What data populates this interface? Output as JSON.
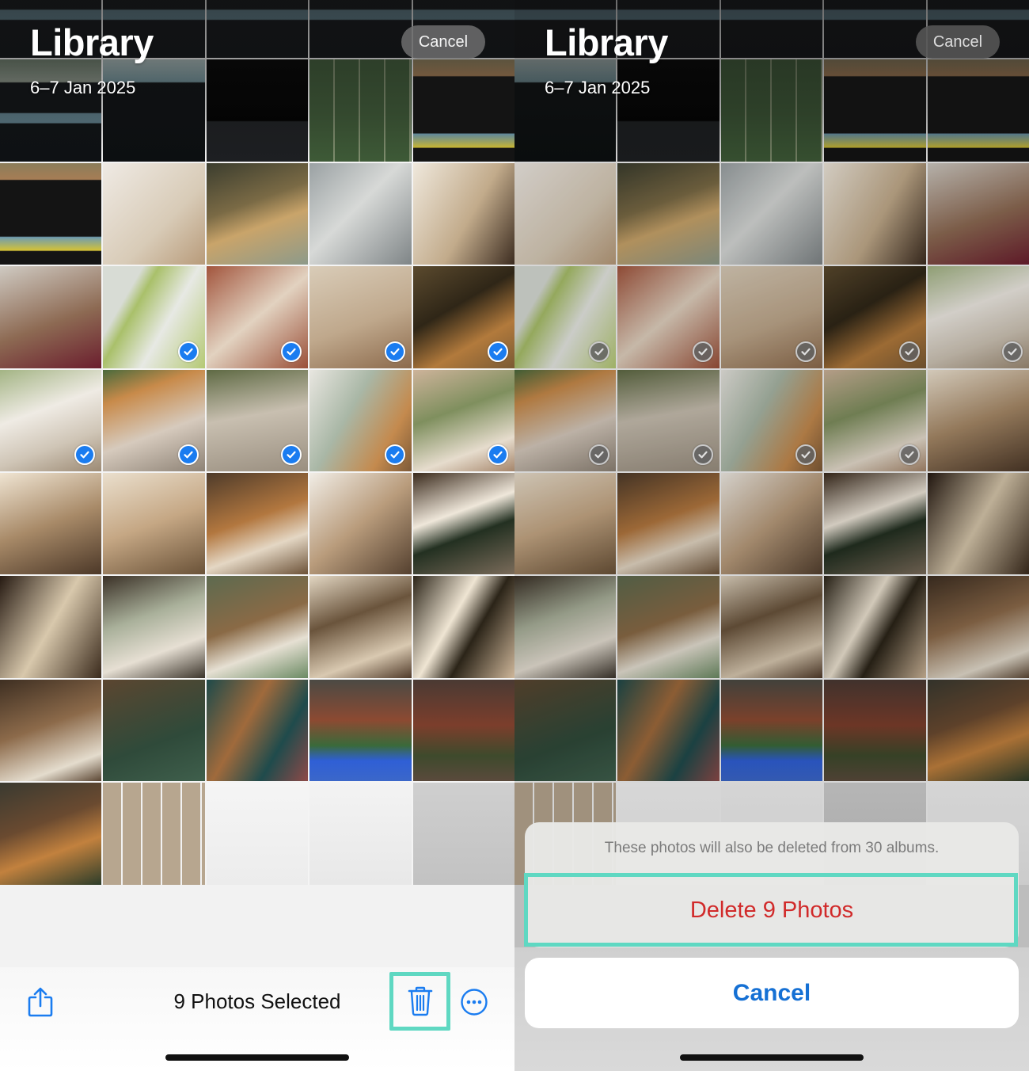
{
  "colors": {
    "accent_blue": "#1a7cf0",
    "destructive_red": "#d12a2a",
    "annotation_teal": "#5fd8c2",
    "cancel_blue": "#1570d4"
  },
  "left_pane": {
    "header": {
      "title": "Library",
      "date_range": "6–7 Jan 2025",
      "cancel_label": "Cancel"
    },
    "toolbar": {
      "share_icon": "share-icon",
      "selection_count_label": "9 Photos Selected",
      "trash_icon": "trash-icon",
      "more_icon": "ellipsis-circle-icon"
    },
    "tiles": [
      {
        "kind": "screenshot-video-editor",
        "selected": false
      },
      {
        "kind": "screenshot-video-editor",
        "selected": false
      },
      {
        "kind": "screenshot-video-editor",
        "selected": false
      },
      {
        "kind": "screenshot-video-editor",
        "selected": false
      },
      {
        "kind": "screenshot-video-editor",
        "selected": false
      },
      {
        "kind": "screenshot-video-editor",
        "selected": false
      },
      {
        "kind": "screenshot-highlight-editor",
        "selected": false
      },
      {
        "kind": "screenshot-no-projects",
        "selected": false
      },
      {
        "kind": "screenshot-photo-picker",
        "selected": false
      },
      {
        "kind": "screenshot-imovie-timeline",
        "selected": false
      },
      {
        "kind": "screenshot-imovie-timeline",
        "selected": false
      },
      {
        "kind": "nursery-interior",
        "selected": false
      },
      {
        "kind": "kitchen-flowers",
        "selected": false
      },
      {
        "kind": "white-tubes-product",
        "selected": false
      },
      {
        "kind": "dining-arched-door",
        "selected": false
      },
      {
        "kind": "arched-kitchen-blossoms",
        "selected": false
      },
      {
        "kind": "green-cosmetic-products",
        "selected": true
      },
      {
        "kind": "terracotta-arched-lounge",
        "selected": true
      },
      {
        "kind": "arched-bathroom",
        "selected": true
      },
      {
        "kind": "moorish-hallway",
        "selected": true
      },
      {
        "kind": "white-courtyard-living",
        "selected": true
      },
      {
        "kind": "orange-tree-courtyard",
        "selected": true
      },
      {
        "kind": "pergola-courtyard",
        "selected": true
      },
      {
        "kind": "lantern-sunroom",
        "selected": true
      },
      {
        "kind": "arched-window-bedroom",
        "selected": true
      },
      {
        "kind": "sunlit-bedroom",
        "selected": false
      },
      {
        "kind": "arched-hallway-stairs",
        "selected": false
      },
      {
        "kind": "staircase-vase",
        "selected": false
      },
      {
        "kind": "bright-staircase-hall",
        "selected": false
      },
      {
        "kind": "dark-archway-mirror",
        "selected": false
      },
      {
        "kind": "dark-doorway-study",
        "selected": false
      },
      {
        "kind": "living-room-garden-view",
        "selected": false
      },
      {
        "kind": "green-bedroom",
        "selected": false
      },
      {
        "kind": "canopy-bedroom-chandelier",
        "selected": false
      },
      {
        "kind": "curtained-bed",
        "selected": false
      },
      {
        "kind": "bookshelf-reading-nook",
        "selected": false
      },
      {
        "kind": "library-green-sofa",
        "selected": false
      },
      {
        "kind": "teal-archway-library",
        "selected": false
      },
      {
        "kind": "brick-cottage-hydrangeas",
        "selected": false
      },
      {
        "kind": "brick-tudor-house",
        "selected": false
      },
      {
        "kind": "cottage-conservatory",
        "selected": false
      },
      {
        "kind": "screenshot-photo-grid",
        "selected": false
      },
      {
        "kind": "screenshot-share-sheet",
        "selected": false
      },
      {
        "kind": "screenshot-albums",
        "selected": false
      },
      {
        "kind": "screenshot-new-album-dialog",
        "selected": false
      }
    ]
  },
  "right_pane": {
    "header": {
      "title": "Library",
      "date_range": "6–7 Jan 2025",
      "cancel_label": "Cancel"
    },
    "action_sheet": {
      "message": "These photos will also be deleted from 30 albums.",
      "delete_label": "Delete 9 Photos",
      "cancel_label": "Cancel"
    },
    "tiles": [
      {
        "kind": "screenshot-video-editor",
        "selected": false
      },
      {
        "kind": "screenshot-video-editor",
        "selected": false
      },
      {
        "kind": "screenshot-video-editor",
        "selected": false
      },
      {
        "kind": "screenshot-video-editor",
        "selected": false
      },
      {
        "kind": "screenshot-video-editor",
        "selected": false
      },
      {
        "kind": "screenshot-highlight-editor",
        "selected": false
      },
      {
        "kind": "screenshot-no-projects",
        "selected": false
      },
      {
        "kind": "screenshot-photo-picker",
        "selected": false
      },
      {
        "kind": "screenshot-imovie-timeline",
        "selected": false
      },
      {
        "kind": "screenshot-imovie-timeline",
        "selected": false
      },
      {
        "kind": "nursery-interior",
        "selected": false
      },
      {
        "kind": "kitchen-flowers",
        "selected": false
      },
      {
        "kind": "white-tubes-product",
        "selected": false
      },
      {
        "kind": "dining-arched-door",
        "selected": false
      },
      {
        "kind": "arched-kitchen-blossoms",
        "selected": false
      },
      {
        "kind": "green-cosmetic-products",
        "selected": true
      },
      {
        "kind": "terracotta-arched-lounge",
        "selected": true
      },
      {
        "kind": "arched-bathroom",
        "selected": true
      },
      {
        "kind": "moorish-hallway",
        "selected": true
      },
      {
        "kind": "white-courtyard-living",
        "selected": true
      },
      {
        "kind": "orange-tree-courtyard",
        "selected": true
      },
      {
        "kind": "pergola-courtyard",
        "selected": true
      },
      {
        "kind": "lantern-sunroom",
        "selected": true
      },
      {
        "kind": "arched-window-bedroom",
        "selected": true
      },
      {
        "kind": "sunlit-bedroom",
        "selected": false
      },
      {
        "kind": "arched-hallway-stairs",
        "selected": false
      },
      {
        "kind": "staircase-vase",
        "selected": false
      },
      {
        "kind": "bright-staircase-hall",
        "selected": false
      },
      {
        "kind": "dark-archway-mirror",
        "selected": false
      },
      {
        "kind": "dark-doorway-study",
        "selected": false
      },
      {
        "kind": "living-room-garden-view",
        "selected": false
      },
      {
        "kind": "green-bedroom",
        "selected": false
      },
      {
        "kind": "canopy-bedroom-chandelier",
        "selected": false
      },
      {
        "kind": "curtained-bed",
        "selected": false
      },
      {
        "kind": "bookshelf-reading-nook",
        "selected": false
      },
      {
        "kind": "library-green-sofa",
        "selected": false
      },
      {
        "kind": "teal-archway-library",
        "selected": false
      },
      {
        "kind": "brick-cottage-hydrangeas",
        "selected": false
      },
      {
        "kind": "brick-tudor-house",
        "selected": false
      },
      {
        "kind": "cottage-conservatory",
        "selected": false
      },
      {
        "kind": "screenshot-photo-grid",
        "selected": false
      },
      {
        "kind": "screenshot-share-sheet",
        "selected": false
      },
      {
        "kind": "screenshot-albums",
        "selected": false
      },
      {
        "kind": "screenshot-new-album-dialog",
        "selected": false
      },
      {
        "kind": "screenshot-albums",
        "selected": false
      }
    ]
  }
}
